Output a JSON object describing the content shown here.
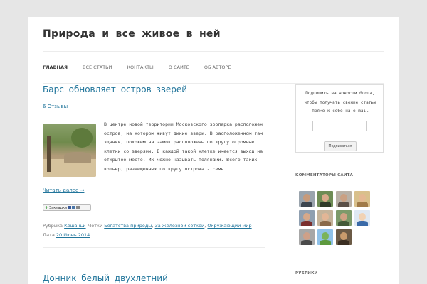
{
  "site": {
    "title": "Природа и все живое в ней"
  },
  "nav": {
    "items": [
      "ГЛАВНАЯ",
      "ВСЕ СТАТЬИ",
      "КОНТАКТЫ",
      "О САЙТЕ",
      "ОБ АВТОРЕ"
    ],
    "active": "ГЛАВНАЯ"
  },
  "post": {
    "title": "Барс обновляет остров зверей",
    "comments": "6 Отзывы",
    "excerpt": "В центре новой территории Московского зоопарка расположен остров, на котором живут дикие звери. В расположенном там здании, похожем на замок расположены по кругу огромные клетки со зверями. В каждой такой клетке имеется выход на открытое место. Их можно называть полянами. Всего таких вольер, размещенных по кругу острова - семь.",
    "read_more": "Читать далее →",
    "share_label": "Закладки",
    "meta": {
      "category_prefix": "Рубрика",
      "category": "Кошачьи",
      "tags_prefix": "Метки",
      "tag1": "Богатства природы",
      "tag2": "За железной сеткой",
      "tag3": "Окружающий мир",
      "date_prefix": "Дата",
      "date": "20 Июнь 2014"
    }
  },
  "post2": {
    "title": "Донник белый двухлетний"
  },
  "sidebar": {
    "subscribe_text": "Подпишись на новости блога, чтобы получать свежие статьи прямо к себе на e-mail",
    "subscribe_value": "",
    "subscribe_button": "Подписаться",
    "commenters_title": "КОММЕНТАТОРЫ САЙТА",
    "categories_title": "РУБРИКИ"
  }
}
